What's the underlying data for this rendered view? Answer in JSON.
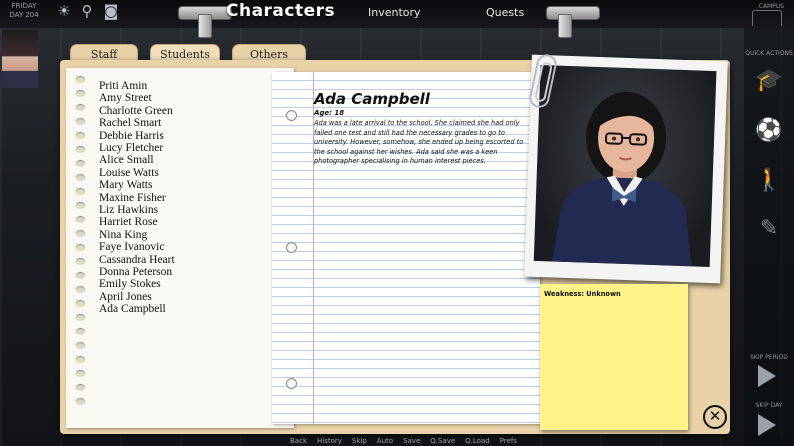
{
  "hud": {
    "day_line1": "FRIDAY",
    "day_line2": "DAY 204",
    "campus_label": "CAMPUS",
    "quick_actions_label": "QUICK ACTIONS",
    "skip_period_label": "SKIP PERIOD",
    "skip_day_label": "SKIP DAY"
  },
  "nav": {
    "title": "Characters",
    "items": [
      "Inventory",
      "Quests"
    ]
  },
  "tabs": [
    "Staff",
    "Students",
    "Others"
  ],
  "active_tab": "Students",
  "students": [
    "Priti Amin",
    "Amy Street",
    "Charlotte Green",
    "Rachel Smart",
    "Debbie Harris",
    "Lucy Fletcher",
    "Alice Small",
    "Louise Watts",
    "Mary Watts",
    "Maxine Fisher",
    "Liz Hawkins",
    "Harriet Rose",
    "Nina King",
    "Faye Ivanovic",
    "Cassandra Heart",
    "Donna Peterson",
    "Emily Stokes",
    "April Jones",
    "Ada Campbell"
  ],
  "profile": {
    "name": "Ada Campbell",
    "age": "Age: 18",
    "bio": "Ada was a late arrival to the school. She claimed she had only failed one test and still had the necessary grades to go to university. However, somehow, she ended up being escorted to the school against her wishes. Ada said she was a keen photographer specialising in human interest pieces.",
    "weakness": "Weakness: Unknown"
  },
  "quick_menu": [
    "Back",
    "History",
    "Skip",
    "Auto",
    "Save",
    "Q.Save",
    "Q.Load",
    "Prefs"
  ],
  "colors": {
    "folder": "#e8d2a8",
    "sticky": "#fdf389",
    "paper_lines": "#b9cfe6",
    "margin": "#e6a0a6"
  }
}
